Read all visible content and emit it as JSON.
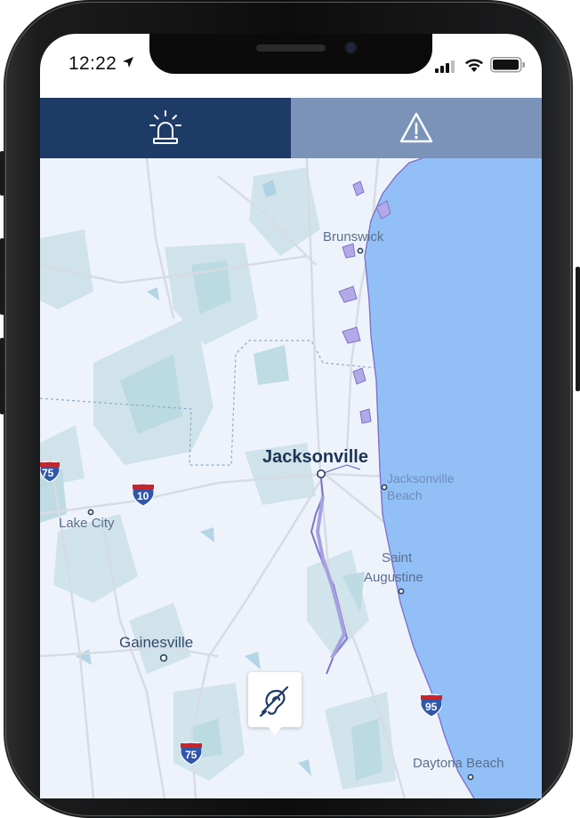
{
  "status_bar": {
    "time": "12:22"
  },
  "tabs": [
    {
      "icon": "siren-icon",
      "active": true
    },
    {
      "icon": "warning-icon",
      "active": false
    }
  ],
  "map": {
    "labels": {
      "brunswick": "Brunswick",
      "jacksonville": "Jacksonville",
      "jacksonville_beach_1": "Jacksonville",
      "jacksonville_beach_2": "Beach",
      "lake_city": "Lake City",
      "saint_augustine_1": "Saint",
      "saint_augustine_2": "Augustine",
      "gainesville": "Gainesville",
      "daytona_beach": "Daytona Beach"
    },
    "shields": {
      "i75_top": "75",
      "i10": "10",
      "i95": "95",
      "i75_bottom": "75"
    }
  },
  "colors": {
    "tab_active": "#1e3a66",
    "tab_inactive": "#7b93b8",
    "ocean": "#93bff7",
    "land": "#eef3fb",
    "coast_outline": "#7d73c9"
  },
  "fab": {
    "icon": "mute-hearing-icon"
  }
}
